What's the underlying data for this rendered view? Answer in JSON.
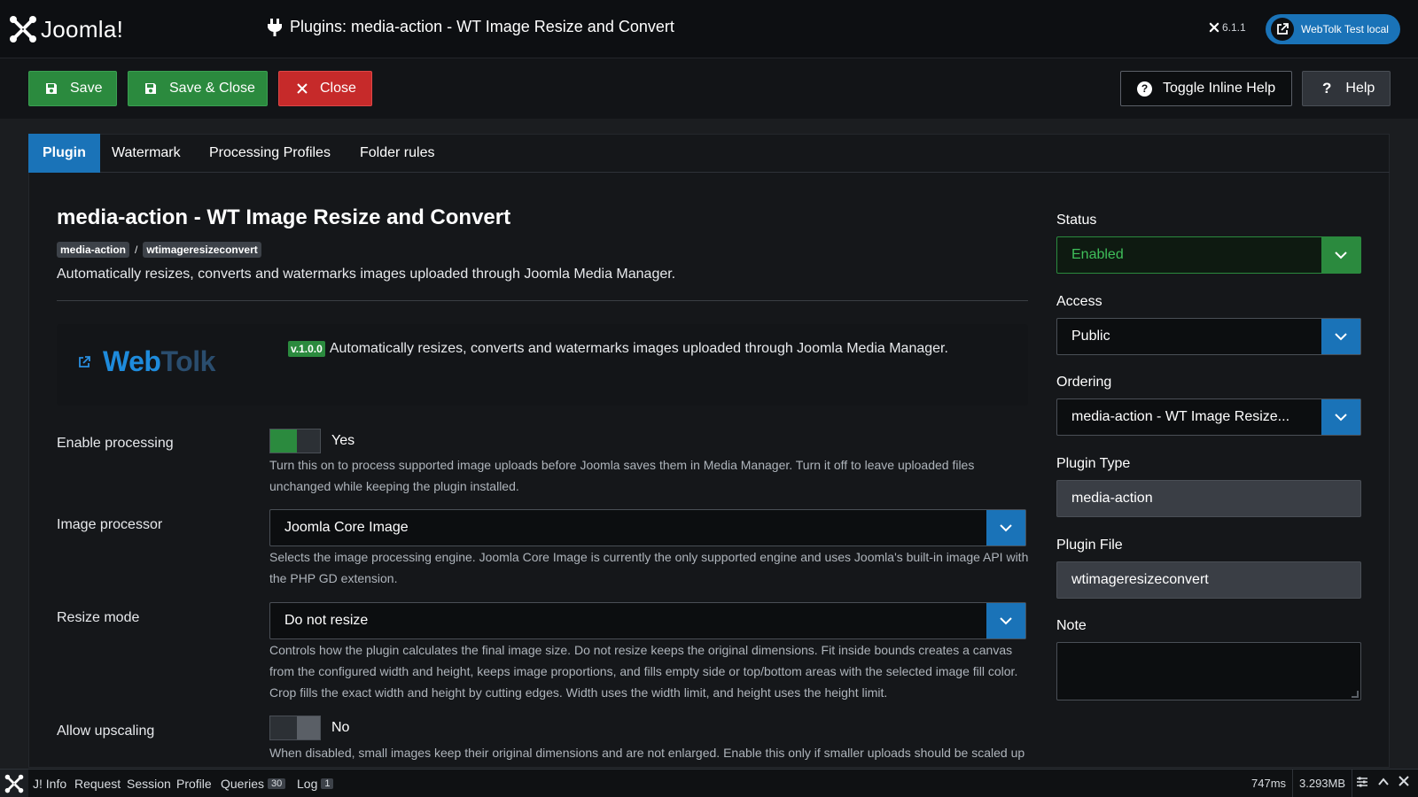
{
  "header": {
    "brand": "Joomla!",
    "title": "Plugins: media-action - WT Image Resize and Convert",
    "version": "6.1.1",
    "site_link": "WebTolk Test local"
  },
  "toolbar": {
    "save": "Save",
    "save_close": "Save & Close",
    "close": "Close",
    "toggle_help": "Toggle Inline Help",
    "help": "Help"
  },
  "tabs": [
    "Plugin",
    "Watermark",
    "Processing Profiles",
    "Folder rules"
  ],
  "plugin": {
    "title": "media-action - WT Image Resize and Convert",
    "group": "media-action",
    "separator": "/",
    "element": "wtimageresizeconvert",
    "description": "Automatically resizes, converts and watermarks images uploaded through Joomla Media Manager.",
    "brand_first": "Web",
    "brand_second": "Tolk",
    "version_badge": "v.1.0.0",
    "promo_text": "Automatically resizes, converts and watermarks images uploaded through Joomla Media Manager."
  },
  "fields": {
    "enable_processing": {
      "label": "Enable processing",
      "value": "Yes",
      "hint": "Turn this on to process supported image uploads before Joomla saves them in Media Manager. Turn it off to leave uploaded files unchanged while keeping the plugin installed."
    },
    "image_processor": {
      "label": "Image processor",
      "value": "Joomla Core Image",
      "hint": "Selects the image processing engine. Joomla Core Image is currently the only supported engine and uses Joomla's built-in image API with the PHP GD extension."
    },
    "resize_mode": {
      "label": "Resize mode",
      "value": "Do not resize",
      "hint": "Controls how the plugin calculates the final image size. Do not resize keeps the original dimensions. Fit inside bounds creates a canvas from the configured width and height, keeps image proportions, and fills empty side or top/bottom areas with the selected image fill color. Crop fills the exact width and height by cutting edges. Width uses the width limit, and height uses the height limit."
    },
    "allow_upscaling": {
      "label": "Allow upscaling",
      "value": "No",
      "hint": "When disabled, small images keep their original dimensions and are not enlarged. Enable this only if smaller uploads should be scaled up"
    }
  },
  "sidebar": {
    "status_label": "Status",
    "status_value": "Enabled",
    "access_label": "Access",
    "access_value": "Public",
    "ordering_label": "Ordering",
    "ordering_value": "media-action - WT Image Resize...",
    "type_label": "Plugin Type",
    "type_value": "media-action",
    "file_label": "Plugin File",
    "file_value": "wtimageresizeconvert",
    "note_label": "Note"
  },
  "debug": {
    "info": "J! Info",
    "request": "Request",
    "session": "Session",
    "profile": "Profile",
    "queries": "Queries",
    "queries_count": "30",
    "log": "Log",
    "log_count": "1",
    "time": "747ms",
    "memory": "3.293MB"
  },
  "colors": {
    "primary": "#1a73b8",
    "success": "#2b8a3e",
    "danger": "#c62a2a",
    "background": "#1b1d20"
  }
}
